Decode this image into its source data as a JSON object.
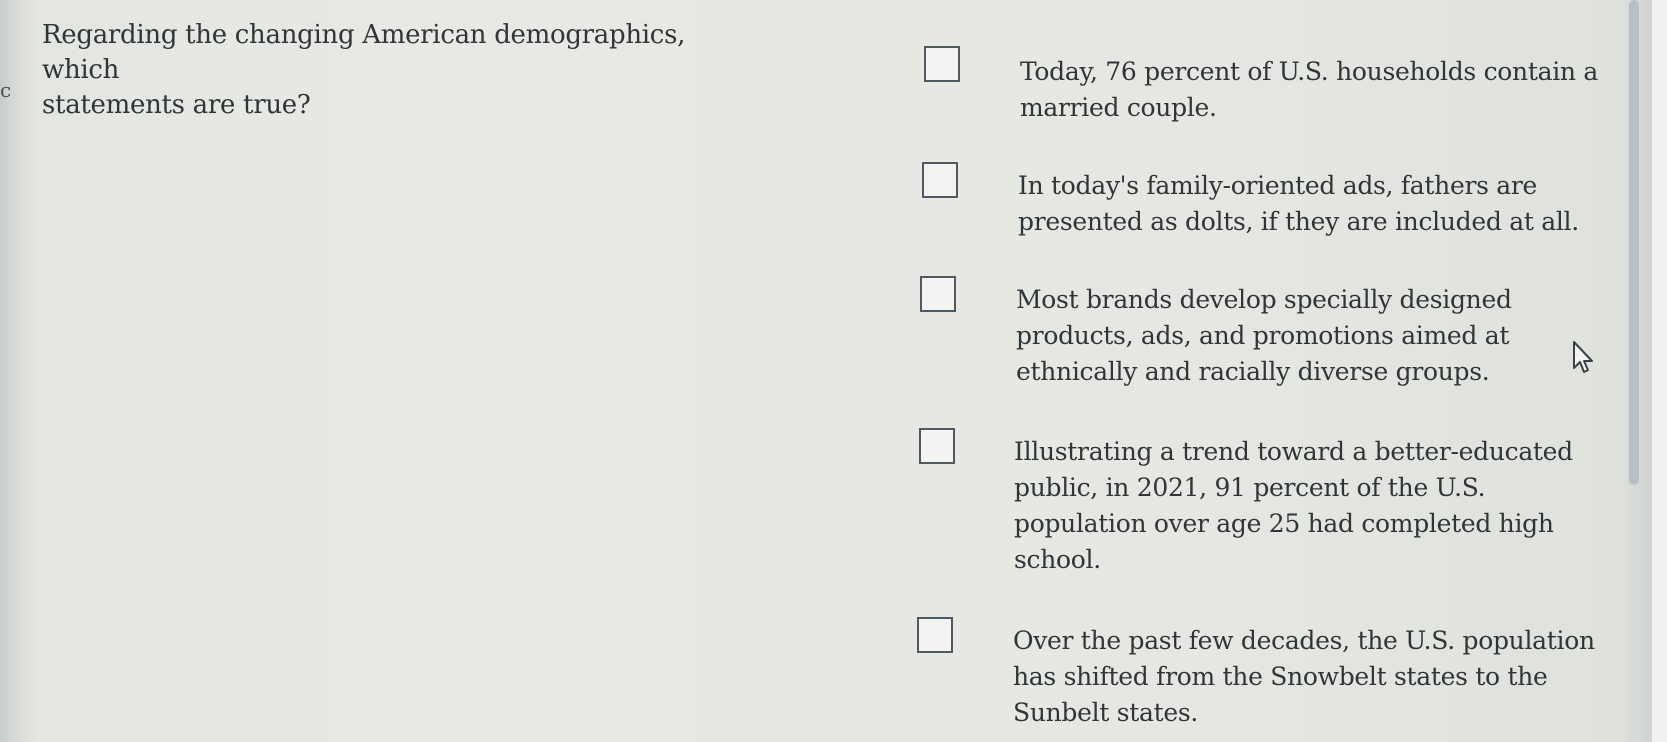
{
  "question": {
    "text": "Regarding the changing American demographics, which\nstatements are true?"
  },
  "left_edge_glyph": "c",
  "options": [
    {
      "text": "Today, 76 percent of U.S. households contain a\nmarried couple.",
      "checked": false
    },
    {
      "text": "In today's family-oriented ads, fathers are\npresented as dolts, if they are included at all.",
      "checked": false
    },
    {
      "text": "Most brands develop specially designed\nproducts, ads, and promotions aimed at\nethnically and racially diverse groups.",
      "checked": false
    },
    {
      "text": "Illustrating a trend toward a better-educated\npublic, in 2021, 91 percent of the U.S.\npopulation over age 25 had completed high\nschool.",
      "checked": false
    },
    {
      "text": "Over the past few decades, the U.S. population\nhas shifted from the Snowbelt states to the\nSunbelt states.",
      "checked": false
    }
  ],
  "icons": {
    "cursor": "mouse-pointer-icon",
    "checkbox": "checkbox-unchecked-icon"
  },
  "colors": {
    "text": "#2f3538",
    "checkbox_border": "#4e5a60",
    "scrollbar_thumb": "#b8c0c7"
  }
}
